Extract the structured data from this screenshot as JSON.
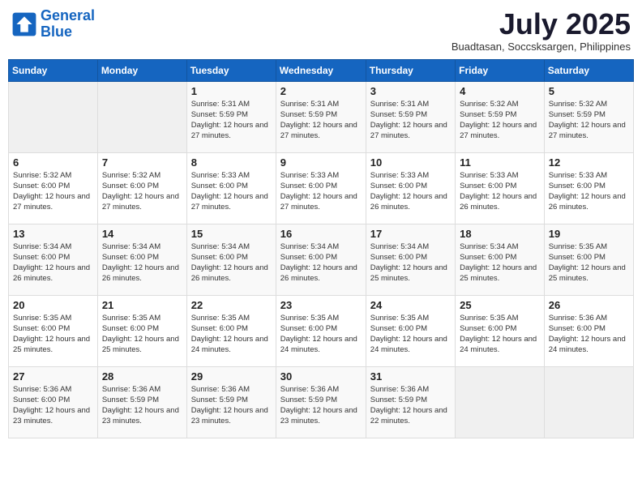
{
  "header": {
    "logo_line1": "General",
    "logo_line2": "Blue",
    "month": "July 2025",
    "location": "Buadtasan, Soccsksargen, Philippines"
  },
  "weekdays": [
    "Sunday",
    "Monday",
    "Tuesday",
    "Wednesday",
    "Thursday",
    "Friday",
    "Saturday"
  ],
  "weeks": [
    [
      {
        "day": "",
        "sunrise": "",
        "sunset": "",
        "daylight": ""
      },
      {
        "day": "",
        "sunrise": "",
        "sunset": "",
        "daylight": ""
      },
      {
        "day": "1",
        "sunrise": "5:31 AM",
        "sunset": "5:59 PM",
        "daylight": "12 hours and 27 minutes."
      },
      {
        "day": "2",
        "sunrise": "5:31 AM",
        "sunset": "5:59 PM",
        "daylight": "12 hours and 27 minutes."
      },
      {
        "day": "3",
        "sunrise": "5:31 AM",
        "sunset": "5:59 PM",
        "daylight": "12 hours and 27 minutes."
      },
      {
        "day": "4",
        "sunrise": "5:32 AM",
        "sunset": "5:59 PM",
        "daylight": "12 hours and 27 minutes."
      },
      {
        "day": "5",
        "sunrise": "5:32 AM",
        "sunset": "5:59 PM",
        "daylight": "12 hours and 27 minutes."
      }
    ],
    [
      {
        "day": "6",
        "sunrise": "5:32 AM",
        "sunset": "6:00 PM",
        "daylight": "12 hours and 27 minutes."
      },
      {
        "day": "7",
        "sunrise": "5:32 AM",
        "sunset": "6:00 PM",
        "daylight": "12 hours and 27 minutes."
      },
      {
        "day": "8",
        "sunrise": "5:33 AM",
        "sunset": "6:00 PM",
        "daylight": "12 hours and 27 minutes."
      },
      {
        "day": "9",
        "sunrise": "5:33 AM",
        "sunset": "6:00 PM",
        "daylight": "12 hours and 27 minutes."
      },
      {
        "day": "10",
        "sunrise": "5:33 AM",
        "sunset": "6:00 PM",
        "daylight": "12 hours and 26 minutes."
      },
      {
        "day": "11",
        "sunrise": "5:33 AM",
        "sunset": "6:00 PM",
        "daylight": "12 hours and 26 minutes."
      },
      {
        "day": "12",
        "sunrise": "5:33 AM",
        "sunset": "6:00 PM",
        "daylight": "12 hours and 26 minutes."
      }
    ],
    [
      {
        "day": "13",
        "sunrise": "5:34 AM",
        "sunset": "6:00 PM",
        "daylight": "12 hours and 26 minutes."
      },
      {
        "day": "14",
        "sunrise": "5:34 AM",
        "sunset": "6:00 PM",
        "daylight": "12 hours and 26 minutes."
      },
      {
        "day": "15",
        "sunrise": "5:34 AM",
        "sunset": "6:00 PM",
        "daylight": "12 hours and 26 minutes."
      },
      {
        "day": "16",
        "sunrise": "5:34 AM",
        "sunset": "6:00 PM",
        "daylight": "12 hours and 26 minutes."
      },
      {
        "day": "17",
        "sunrise": "5:34 AM",
        "sunset": "6:00 PM",
        "daylight": "12 hours and 25 minutes."
      },
      {
        "day": "18",
        "sunrise": "5:34 AM",
        "sunset": "6:00 PM",
        "daylight": "12 hours and 25 minutes."
      },
      {
        "day": "19",
        "sunrise": "5:35 AM",
        "sunset": "6:00 PM",
        "daylight": "12 hours and 25 minutes."
      }
    ],
    [
      {
        "day": "20",
        "sunrise": "5:35 AM",
        "sunset": "6:00 PM",
        "daylight": "12 hours and 25 minutes."
      },
      {
        "day": "21",
        "sunrise": "5:35 AM",
        "sunset": "6:00 PM",
        "daylight": "12 hours and 25 minutes."
      },
      {
        "day": "22",
        "sunrise": "5:35 AM",
        "sunset": "6:00 PM",
        "daylight": "12 hours and 24 minutes."
      },
      {
        "day": "23",
        "sunrise": "5:35 AM",
        "sunset": "6:00 PM",
        "daylight": "12 hours and 24 minutes."
      },
      {
        "day": "24",
        "sunrise": "5:35 AM",
        "sunset": "6:00 PM",
        "daylight": "12 hours and 24 minutes."
      },
      {
        "day": "25",
        "sunrise": "5:35 AM",
        "sunset": "6:00 PM",
        "daylight": "12 hours and 24 minutes."
      },
      {
        "day": "26",
        "sunrise": "5:36 AM",
        "sunset": "6:00 PM",
        "daylight": "12 hours and 24 minutes."
      }
    ],
    [
      {
        "day": "27",
        "sunrise": "5:36 AM",
        "sunset": "6:00 PM",
        "daylight": "12 hours and 23 minutes."
      },
      {
        "day": "28",
        "sunrise": "5:36 AM",
        "sunset": "5:59 PM",
        "daylight": "12 hours and 23 minutes."
      },
      {
        "day": "29",
        "sunrise": "5:36 AM",
        "sunset": "5:59 PM",
        "daylight": "12 hours and 23 minutes."
      },
      {
        "day": "30",
        "sunrise": "5:36 AM",
        "sunset": "5:59 PM",
        "daylight": "12 hours and 23 minutes."
      },
      {
        "day": "31",
        "sunrise": "5:36 AM",
        "sunset": "5:59 PM",
        "daylight": "12 hours and 22 minutes."
      },
      {
        "day": "",
        "sunrise": "",
        "sunset": "",
        "daylight": ""
      },
      {
        "day": "",
        "sunrise": "",
        "sunset": "",
        "daylight": ""
      }
    ]
  ]
}
